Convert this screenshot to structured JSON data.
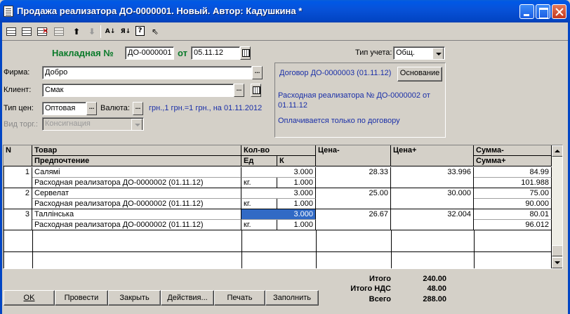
{
  "window": {
    "title": "Продажа реализатора  ДО-0000001. Новый. Автор: Кадушкина *"
  },
  "toolbar": {
    "icons": [
      "grid-icon",
      "grid-add-icon",
      "grid-delete-icon",
      "grid-copy-icon",
      "arrow-up-icon",
      "arrow-down-icon",
      "sort-asc-icon",
      "sort-desc-icon",
      "help-icon",
      "pointer-help-icon"
    ],
    "sort_asc": "А↓",
    "sort_desc": "Я↓",
    "help": "?"
  },
  "header": {
    "invoice_label": "Накладная №",
    "invoice_number": "ДО-0000001",
    "from_label": "от",
    "date": "05.11.12",
    "accounting_type_label": "Тип учета:",
    "accounting_type": "Общ."
  },
  "form": {
    "firm_label": "Фирма:",
    "firm": "Добро",
    "client_label": "Клиент:",
    "client": "Смак",
    "price_type_label": "Тип цен:",
    "price_type": "Оптовая",
    "currency_label": "Валюта:",
    "currency_info": "грн.,1 грн.=1 грн., на 01.11.2012",
    "trade_type_label": "Вид торг.:",
    "trade_type": "Консигнация",
    "ellipsis": "..."
  },
  "contract": {
    "title": "Договор ДО-0000003 (01.11.12)",
    "basis_button": "Основание",
    "basis_doc": "Расходная реализатора № ДО-0000002 от 01.11.12",
    "payment_note": "Оплачивается только по договору"
  },
  "table": {
    "headers": {
      "n": "N",
      "product": "Товар",
      "preference": "Предпочтение",
      "qty": "Кол-во",
      "unit": "Ед",
      "k": "К",
      "price_minus": "Цена-",
      "price_plus": "Цена+",
      "sum_minus": "Сумма-",
      "sum_plus": "Сумма+"
    },
    "rows": [
      {
        "n": "1",
        "product": "Салямі",
        "preference": "Расходная реализатора ДО-0000002 (01.11.12)",
        "qty": "3.000",
        "unit": "кг.",
        "k": "1.000",
        "price_minus": "28.33",
        "price_plus": "33.996",
        "sum_minus": "84.99",
        "sum_plus": "101.988"
      },
      {
        "n": "2",
        "product": "Сервелат",
        "preference": "Расходная реализатора ДО-0000002 (01.11.12)",
        "qty": "3.000",
        "unit": "кг.",
        "k": "1.000",
        "price_minus": "25.00",
        "price_plus": "30.000",
        "sum_minus": "75.00",
        "sum_plus": "90.000"
      },
      {
        "n": "3",
        "product": "Таллінська",
        "preference": "Расходная реализатора ДО-0000002 (01.11.12)",
        "qty": "3.000",
        "unit": "кг.",
        "k": "1.000",
        "price_minus": "26.67",
        "price_plus": "32.004",
        "sum_minus": "80.01",
        "sum_plus": "96.012"
      }
    ]
  },
  "totals": {
    "total_label": "Итого",
    "total": "240.00",
    "vat_label": "Итого НДС",
    "vat": "48.00",
    "grand_label": "Всего",
    "grand": "288.00"
  },
  "buttons": {
    "ok": "OK",
    "post": "Провести",
    "close": "Закрыть",
    "actions": "Действия...",
    "print": "Печать",
    "fill": "Заполнить"
  }
}
